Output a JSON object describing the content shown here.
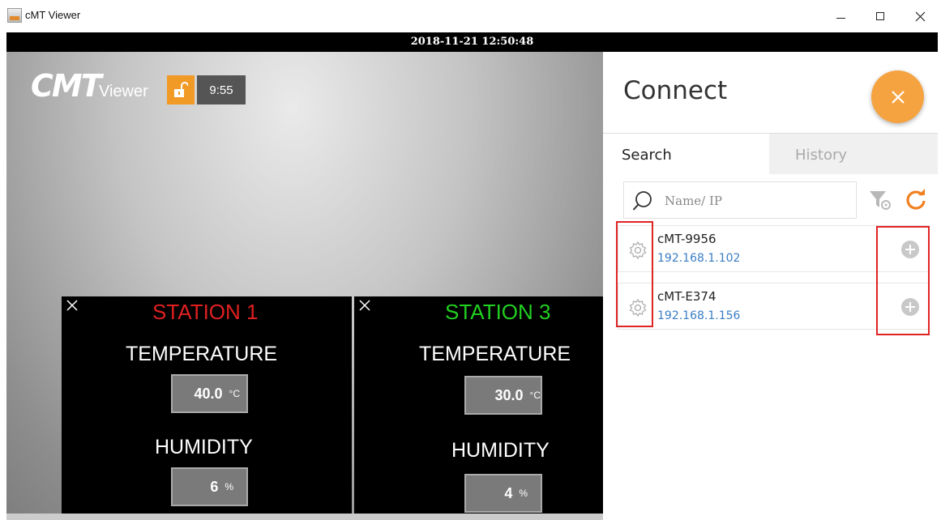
{
  "window": {
    "title": "cMT Viewer"
  },
  "datebar": {
    "datetime": "2018-11-21 12:50:48"
  },
  "viewer": {
    "logo_main": "CMT",
    "logo_sub": "Viewer",
    "timer": "9:55",
    "stations": [
      {
        "title": "STATION 1",
        "title_color": "#e02020",
        "temperature_label": "TEMPERATURE",
        "temperature_value": "40.0",
        "temperature_unit": "°C",
        "humidity_label": "HUMIDITY",
        "humidity_value": "6",
        "humidity_unit": "%"
      },
      {
        "title": "STATION 3",
        "title_color": "#22d022",
        "temperature_label": "TEMPERATURE",
        "temperature_value": "30.0",
        "temperature_unit": "°C",
        "humidity_label": "HUMIDITY",
        "humidity_value": "4",
        "humidity_unit": "%"
      }
    ]
  },
  "panel": {
    "title": "Connect",
    "tabs": [
      {
        "label": "Search",
        "active": true
      },
      {
        "label": "History",
        "active": false
      }
    ],
    "search": {
      "placeholder": "Name/ IP",
      "value": ""
    },
    "devices": [
      {
        "name": "cMT-9956",
        "ip": "192.168.1.102"
      },
      {
        "name": "cMT-E374",
        "ip": "192.168.1.156"
      }
    ]
  },
  "colors": {
    "accent_orange": "#f5a341",
    "ip_blue": "#3a7dc4",
    "highlight_red": "#e02424"
  },
  "icons": [
    "app-icon",
    "minimize-icon",
    "maximize-icon",
    "close-icon",
    "unlock-icon",
    "search-icon",
    "filter-icon",
    "refresh-icon",
    "gear-icon",
    "add-icon"
  ]
}
